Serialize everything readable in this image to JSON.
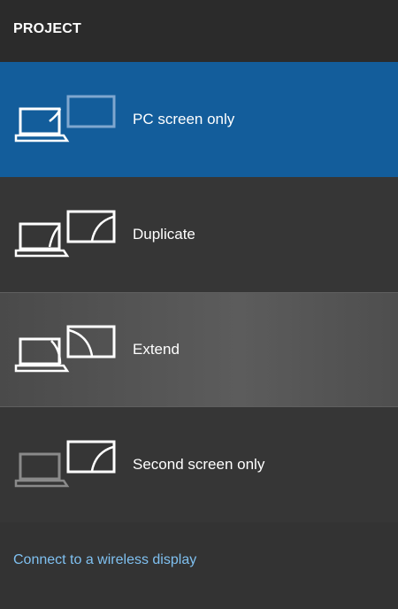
{
  "header": {
    "title": "PROJECT"
  },
  "options": [
    {
      "label": "PC screen only",
      "icon": "pc-screen-only-icon",
      "state": "selected"
    },
    {
      "label": "Duplicate",
      "icon": "duplicate-icon",
      "state": "normal"
    },
    {
      "label": "Extend",
      "icon": "extend-icon",
      "state": "hovered"
    },
    {
      "label": "Second screen only",
      "icon": "second-screen-only-icon",
      "state": "normal"
    }
  ],
  "footer": {
    "link_label": "Connect to a wireless display"
  },
  "colors": {
    "header_bg": "#2b2b2b",
    "selected_bg": "#135d9b",
    "panel_bg": "#363636",
    "link": "#7fc0f0"
  }
}
